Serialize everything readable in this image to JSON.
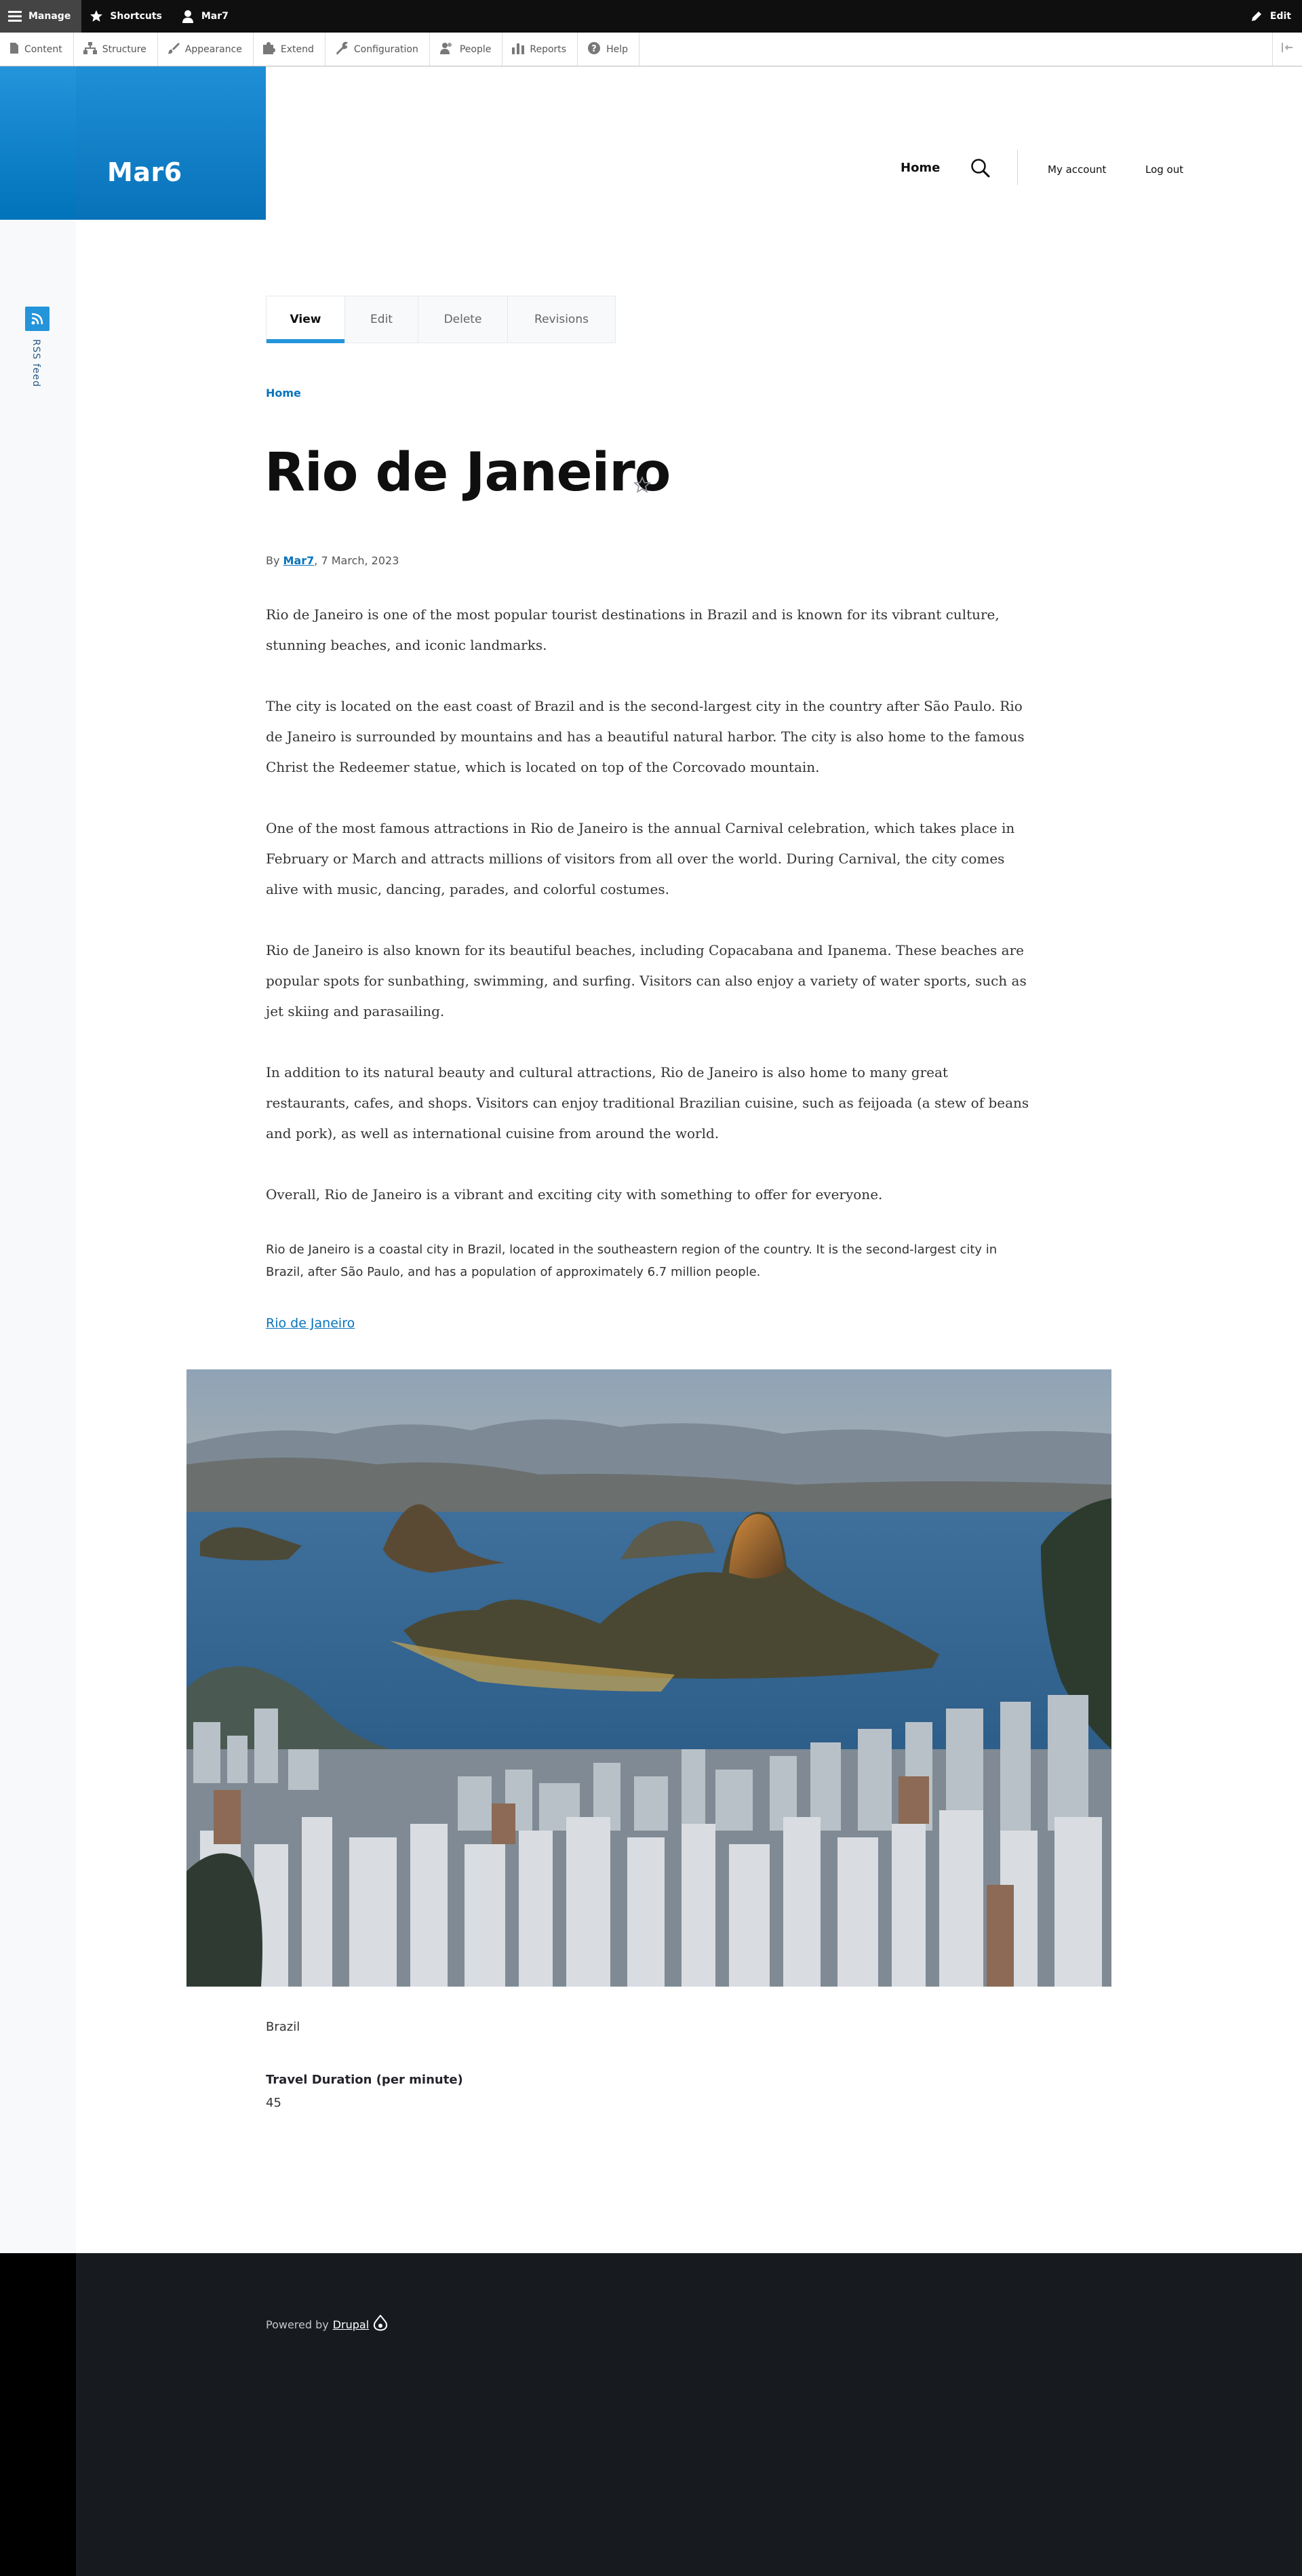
{
  "toolbar": {
    "manage_label": "Manage",
    "shortcuts_label": "Shortcuts",
    "user_label": "Mar7",
    "edit_label": "Edit"
  },
  "tray": {
    "items": [
      {
        "label": "Content",
        "icon": "document-icon"
      },
      {
        "label": "Structure",
        "icon": "structure-icon"
      },
      {
        "label": "Appearance",
        "icon": "paintbrush-icon"
      },
      {
        "label": "Extend",
        "icon": "puzzle-icon"
      },
      {
        "label": "Configuration",
        "icon": "wrench-icon"
      },
      {
        "label": "People",
        "icon": "people-icon"
      },
      {
        "label": "Reports",
        "icon": "bar-chart-icon"
      },
      {
        "label": "Help",
        "icon": "help-icon"
      }
    ]
  },
  "site": {
    "name": "Mar6",
    "brand_color": "#0873bb"
  },
  "nav": {
    "home": "Home",
    "my_account": "My account",
    "logout": "Log out"
  },
  "rss": {
    "label": "RSS feed"
  },
  "tabs": {
    "view": "View",
    "edit": "Edit",
    "delete": "Delete",
    "revisions": "Revisions"
  },
  "breadcrumb": {
    "home": "Home"
  },
  "article": {
    "title": "Rio de Janeiro",
    "byline_prefix": "By",
    "author": "Mar7",
    "date": ", 7 March, 2023",
    "paragraphs": [
      "Rio de Janeiro is one of the most popular tourist destinations in Brazil and is known for its vibrant culture, stunning beaches, and iconic landmarks.",
      "The city is located on the east coast of Brazil and is the second-largest city in the country after São Paulo. Rio de Janeiro is surrounded by mountains and has a beautiful natural harbor. The city is also home to the famous Christ the Redeemer statue, which is located on top of the Corcovado mountain.",
      "One of the most famous attractions in Rio de Janeiro is the annual Carnival celebration, which takes place in February or March and attracts millions of visitors from all over the world. During Carnival, the city comes alive with music, dancing, parades, and colorful costumes.",
      "Rio de Janeiro is also known for its beautiful beaches, including Copacabana and Ipanema. These beaches are popular spots for sunbathing, swimming, and surfing. Visitors can also enjoy a variety of water sports, such as jet skiing and parasailing.",
      "In addition to its natural beauty and cultural attractions, Rio de Janeiro is also home to many great restaurants, cafes, and shops. Visitors can enjoy traditional Brazilian cuisine, such as feijoada (a stew of beans and pork), as well as international cuisine from around the world.",
      "Overall, Rio de Janeiro is a vibrant and exciting city with something to offer for everyone."
    ],
    "summary": "Rio de Janeiro is a coastal city in Brazil, located in the southeastern region of the country. It is the second-largest city in Brazil, after São Paulo, and has a population of approximately 6.7 million people.",
    "link_text": "Rio de Janeiro",
    "country": "Brazil",
    "travel_duration_label": "Travel Duration (per minute)",
    "travel_duration_value": "45"
  },
  "footer": {
    "powered_by": "Powered by",
    "drupal": "Drupal"
  }
}
